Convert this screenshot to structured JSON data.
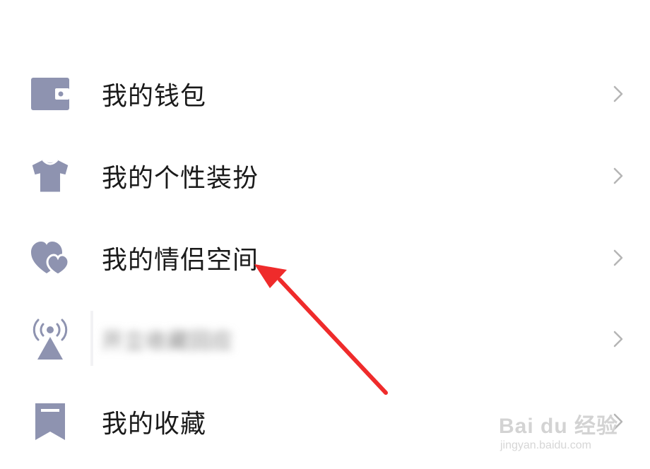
{
  "menu": {
    "items": [
      {
        "label": "我的钱包",
        "icon": "wallet-icon"
      },
      {
        "label": "我的个性装扮",
        "icon": "shirt-icon"
      },
      {
        "label": "我的情侣空间",
        "icon": "hearts-icon"
      },
      {
        "label": "开立收藏回应",
        "icon": "broadcast-icon",
        "blurred": true
      },
      {
        "label": "我的收藏",
        "icon": "bookmark-icon"
      }
    ]
  },
  "colors": {
    "icon": "#8e93b0",
    "text": "#1a1a1a",
    "chevron": "#b5b5b5",
    "arrow": "#ef2b2b"
  },
  "watermark": {
    "brand": "Bai du 经验",
    "url": "jingyan.baidu.com"
  }
}
